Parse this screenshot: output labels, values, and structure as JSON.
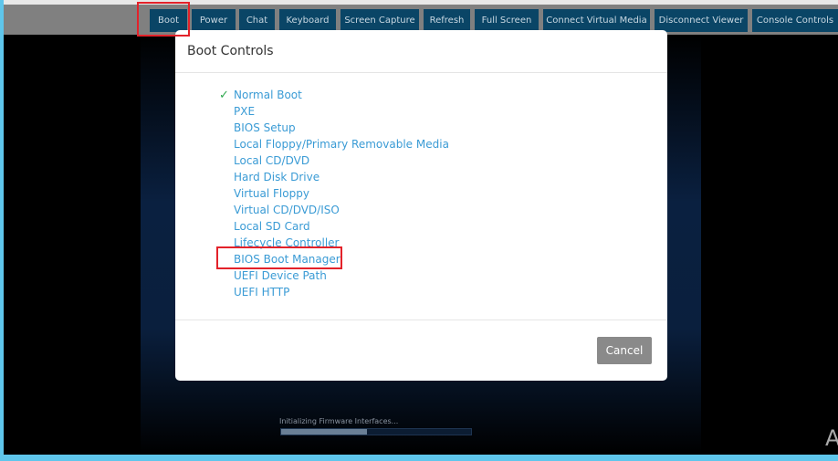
{
  "toolbar": {
    "buttons": [
      "Boot",
      "Power",
      "Chat",
      "Keyboard",
      "Screen Capture",
      "Refresh",
      "Full Screen",
      "Connect Virtual Media",
      "Disconnect Viewer",
      "Console Controls"
    ]
  },
  "console": {
    "status_text": "Initializing Firmware Interfaces...",
    "progress_percent": 45,
    "corner_text": "A"
  },
  "modal": {
    "title": "Boot Controls",
    "selected": "Normal Boot",
    "check_icon": "✓",
    "options": [
      "Normal Boot",
      "PXE",
      "BIOS Setup",
      "Local Floppy/Primary Removable Media",
      "Local CD/DVD",
      "Hard Disk Drive",
      "Virtual Floppy",
      "Virtual CD/DVD/ISO",
      "Local SD Card",
      "Lifecycle Controller",
      "BIOS Boot Manager",
      "UEFI Device Path",
      "UEFI HTTP"
    ],
    "cancel_label": "Cancel"
  },
  "colors": {
    "button_bg": "#0a4566",
    "link": "#3a9bd5",
    "highlight": "#e3222a"
  }
}
